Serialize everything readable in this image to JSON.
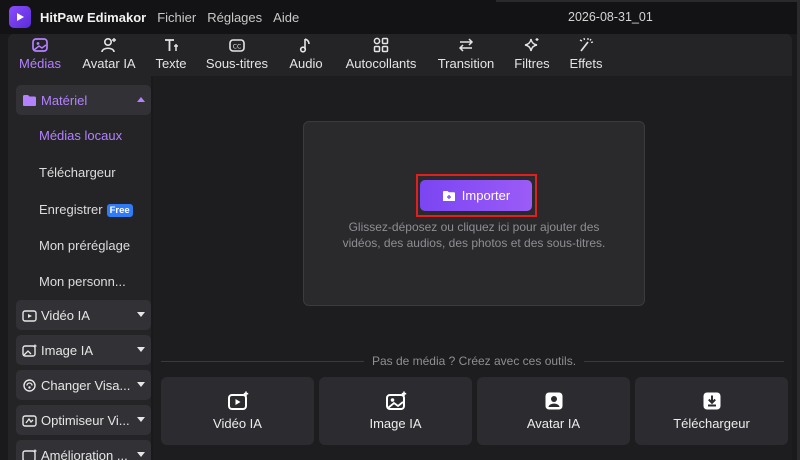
{
  "titlebar": {
    "app_name": "HitPaw Edimakor",
    "menus": [
      "Fichier",
      "Réglages",
      "Aide"
    ],
    "project_name": "2026-08-31_01"
  },
  "toolbar": {
    "tabs": [
      {
        "label": "Médias",
        "icon": "media-icon",
        "active": true
      },
      {
        "label": "Avatar IA",
        "icon": "avatar-icon"
      },
      {
        "label": "Texte",
        "icon": "text-icon"
      },
      {
        "label": "Sous-titres",
        "icon": "subtitles-icon"
      },
      {
        "label": "Audio",
        "icon": "music-note-icon"
      },
      {
        "label": "Autocollants",
        "icon": "stickers-icon"
      },
      {
        "label": "Transition",
        "icon": "transition-icon"
      },
      {
        "label": "Filtres",
        "icon": "sparkle-icon"
      },
      {
        "label": "Effets",
        "icon": "magic-wand-icon"
      }
    ]
  },
  "sidebar": {
    "material": {
      "label": "Matériel",
      "icon": "folder-icon"
    },
    "material_items": [
      "Médias locaux",
      "Téléchargeur",
      "Enregistrer",
      "Mon préréglage",
      "Mon personn..."
    ],
    "free_badge": "Free",
    "groups": [
      {
        "label": "Vidéo IA",
        "icon": "video-ai-icon"
      },
      {
        "label": "Image IA",
        "icon": "image-ai-icon"
      },
      {
        "label": "Changer Visa...",
        "icon": "face-swap-icon"
      },
      {
        "label": "Optimiseur Vi...",
        "icon": "optimizer-icon"
      },
      {
        "label": "Amélioration ...",
        "icon": "enhance-icon"
      }
    ]
  },
  "main": {
    "import_label": "Importer",
    "drop_hint_line1": "Glissez-déposez ou cliquez ici pour ajouter des",
    "drop_hint_line2": "vidéos, des audios, des photos et des sous-titres.",
    "divider_text": "Pas de média ? Créez avec ces outils.",
    "tools": [
      {
        "label": "Vidéo IA",
        "icon": "video-ai-icon"
      },
      {
        "label": "Image IA",
        "icon": "image-ai-icon"
      },
      {
        "label": "Avatar IA",
        "icon": "avatar-icon"
      },
      {
        "label": "Téléchargeur",
        "icon": "download-icon"
      }
    ]
  },
  "colors": {
    "accent": "#b481ff",
    "import_button": "#8a50f5",
    "highlight_box": "#e0201f",
    "free_badge": "#2f7cf6"
  }
}
